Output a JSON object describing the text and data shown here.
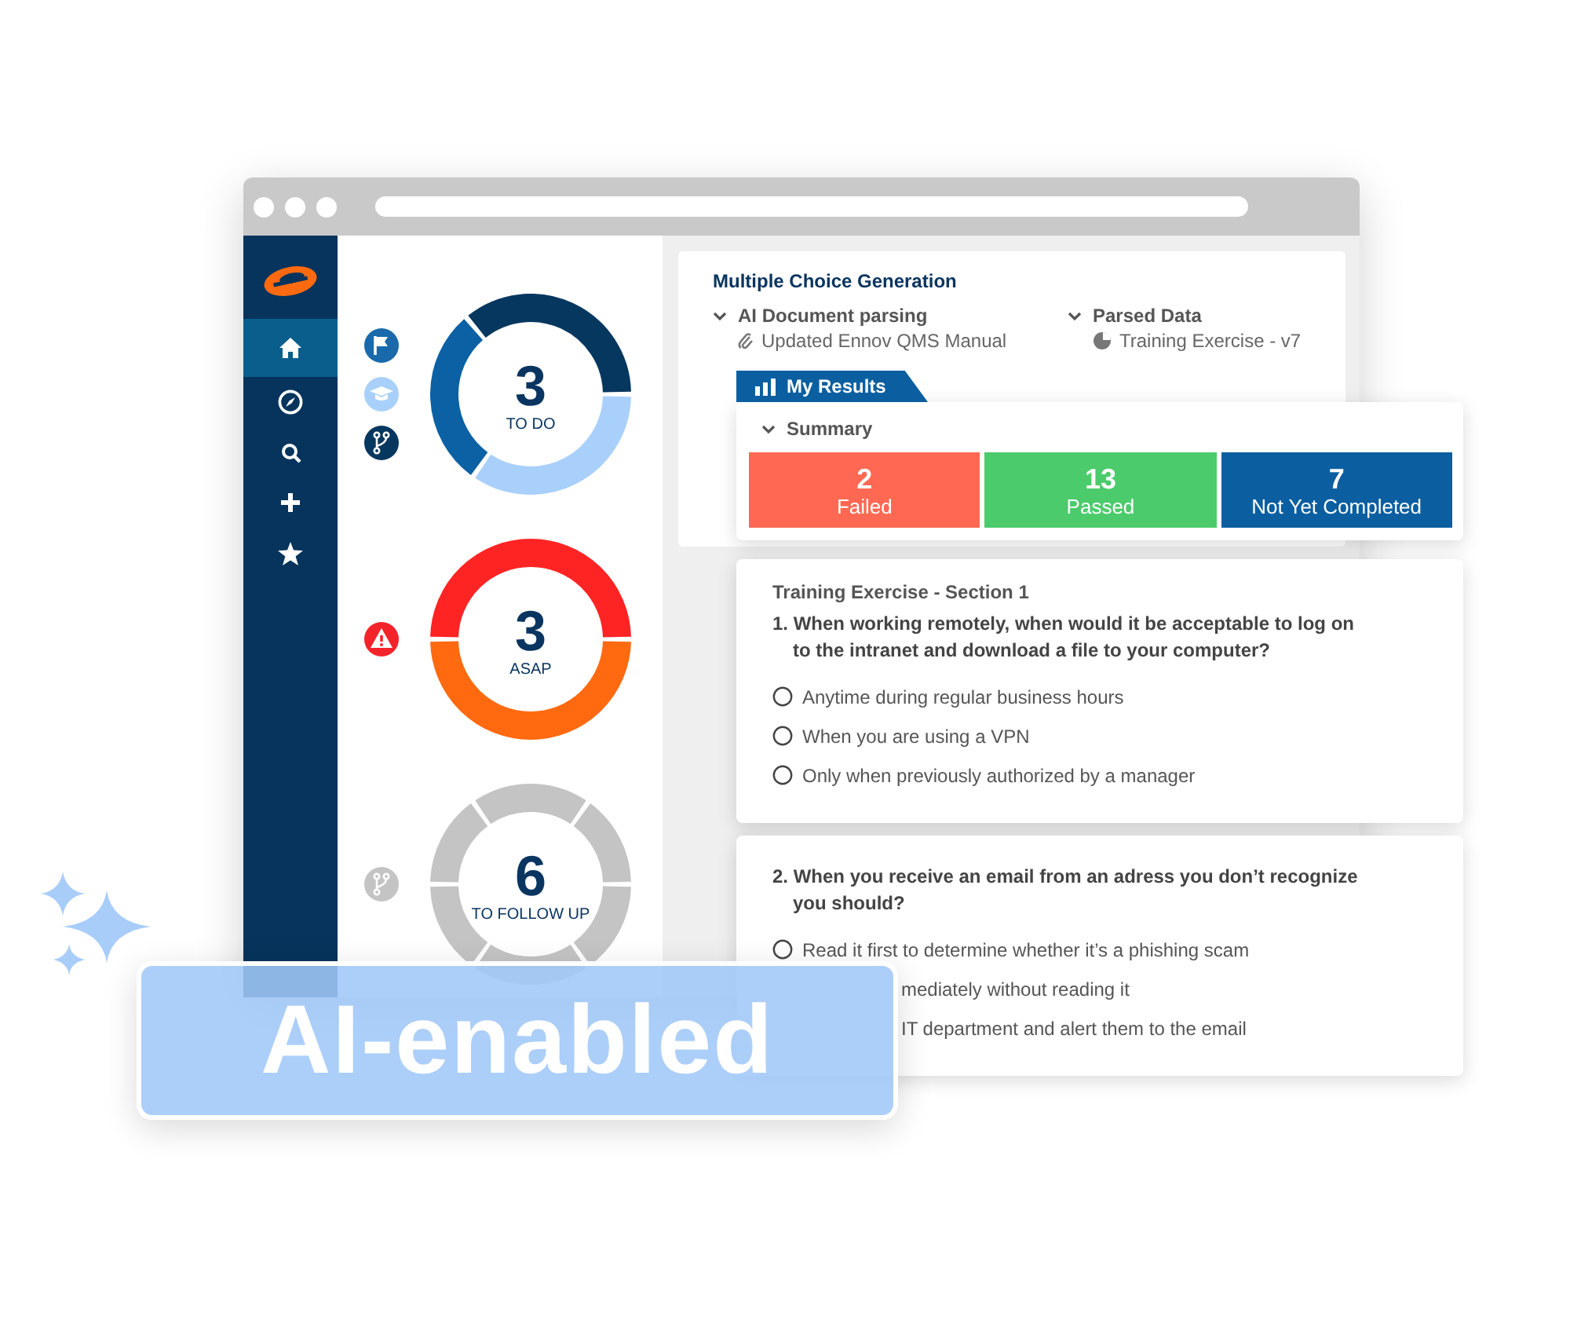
{
  "sidebar": {
    "items": [
      {
        "kind": "home",
        "selected": true
      },
      {
        "kind": "compass",
        "selected": false
      },
      {
        "kind": "search",
        "selected": false
      },
      {
        "kind": "plus",
        "selected": false
      },
      {
        "kind": "star",
        "selected": false
      }
    ]
  },
  "donuts": [
    {
      "kind": "to_do",
      "count": "3",
      "label": "TO DO"
    },
    {
      "kind": "asap",
      "count": "3",
      "label": "ASAP"
    },
    {
      "kind": "follow_up",
      "count": "6",
      "label": "TO FOLLOW UP"
    }
  ],
  "generation": {
    "title": "Multiple Choice Generation",
    "sources": [
      {
        "kind": "attachment",
        "heading": "AI Document parsing",
        "expanded": true,
        "file": "Updated Ennov QMS Manual"
      },
      {
        "kind": "pie",
        "heading": "Parsed Data",
        "expanded": true,
        "file": "Training Exercise - v7"
      }
    ]
  },
  "results_tab": {
    "label": "My Results",
    "selected": true
  },
  "summary": {
    "title": "Summary",
    "expanded": true,
    "tiles": [
      {
        "count": "2",
        "label": "Failed",
        "color": "#ff6853"
      },
      {
        "count": "13",
        "label": "Passed",
        "color": "#4ccb6c"
      },
      {
        "count": "7",
        "label": "Not Yet Completed",
        "color": "#0b5fa0"
      }
    ]
  },
  "questions": [
    {
      "section": "Training Exercise - Section 1",
      "text": "1. When working remotely, when would it be acceptable to log on to the intranet and download a file to your computer?",
      "options": [
        {
          "label": "Anytime during regular business hours",
          "selected": false
        },
        {
          "label": "When you are using a VPN",
          "selected": false
        },
        {
          "label": "Only when previously authorized by a manager",
          "selected": false
        }
      ]
    },
    {
      "text": "2. When you receive an email from an adress you don’t recognize you should?",
      "options": [
        {
          "label": "Read it first to determine whether it’s a phishing scam",
          "selected": false
        },
        {
          "label": "mediately without reading it"
        },
        {
          "label": "IT department and alert them to the email"
        }
      ]
    }
  ],
  "badge": {
    "text": "AI-enabled"
  }
}
